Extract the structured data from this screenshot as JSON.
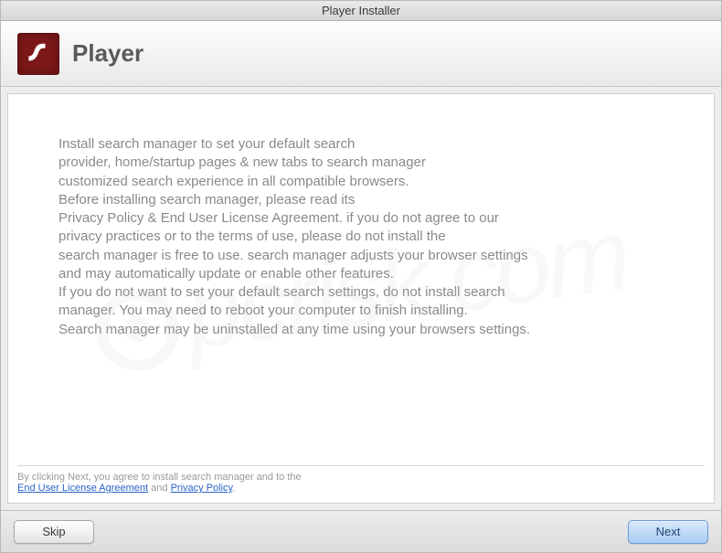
{
  "window": {
    "title": "Player Installer"
  },
  "header": {
    "title": "Player",
    "icon": "flash-player-icon"
  },
  "body": {
    "text": "Install search manager to set your default search\nprovider, home/startup pages & new tabs to search manager\ncustomized search experience in all compatible browsers.\nBefore installing search manager, please read its\nPrivacy Policy & End User License Agreement. if you do not agree to our\nprivacy practices or to the terms of use, please do not install the\nsearch manager is free to use. search manager adjusts your browser settings\nand may automatically update or enable other features.\nIf you do not want to set your default search settings, do not install search\nmanager. You may need to reboot your computer to finish installing.\nSearch manager may be uninstalled at any time using your browsers settings."
  },
  "agreement": {
    "prefix": "By clicking Next, you agree to install search manager and to the",
    "eula_link": "End User License Agreement",
    "connector": " and ",
    "privacy_link": "Privacy Policy",
    "suffix": "."
  },
  "footer": {
    "skip": "Skip",
    "next": "Next"
  },
  "watermark": "pcrisk.com"
}
